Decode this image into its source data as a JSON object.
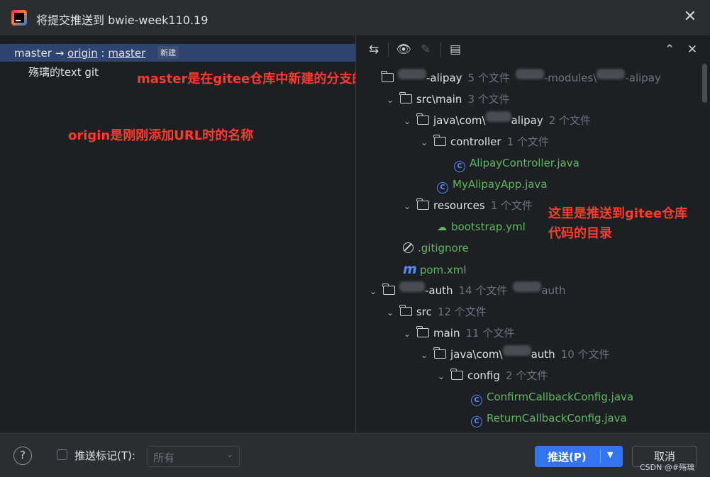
{
  "dialog": {
    "title": "将提交推送到 bwie-week110.19"
  },
  "commits": {
    "branch_local": "master",
    "arrow": "→",
    "remote": "origin",
    "sep": ":",
    "branch_remote": "master",
    "badge": "新建",
    "message": "殇璃的text git"
  },
  "annotations": {
    "branch_note": "master是在gitee仓库中新建的分支的名称",
    "remote_note": "origin是刚刚添加URL时的名称",
    "tree_note_line1": "这里是推送到gitee仓库",
    "tree_note_line2": "代码的目录"
  },
  "tree": [
    {
      "name": "-alipay",
      "count": "5 个文件",
      "path1": "-modules\\",
      "path2": "-alipay"
    },
    {
      "name": "src\\main",
      "count": "3 个文件"
    },
    {
      "name_a": "java\\com\\",
      "name_b": "alipay",
      "count": "2 个文件"
    },
    {
      "name": "controller",
      "count": "1 个文件"
    },
    {
      "name": "AlipayController.java"
    },
    {
      "name": "MyAlipayApp.java"
    },
    {
      "name": "resources",
      "count": "1 个文件"
    },
    {
      "name": "bootstrap.yml"
    },
    {
      "name": ".gitignore"
    },
    {
      "name": "pom.xml"
    },
    {
      "name": "-auth",
      "count": "14 个文件",
      "path": "auth"
    },
    {
      "name": "src",
      "count": "12 个文件"
    },
    {
      "name": "main",
      "count": "11 个文件"
    },
    {
      "name_a": "java\\com\\",
      "name_b": "auth",
      "count": "10 个文件"
    },
    {
      "name": "config",
      "count": "2 个文件"
    },
    {
      "name": "ConfirmCallbackConfig.java"
    },
    {
      "name": "ReturnCallbackConfig.java"
    }
  ],
  "footer": {
    "help": "?",
    "push_tags_label": "推送标记(T):",
    "tags_select_value": "所有",
    "push_label": "推送(P)",
    "cancel_label": "取消",
    "watermark": "CSDN @#殇璃"
  }
}
